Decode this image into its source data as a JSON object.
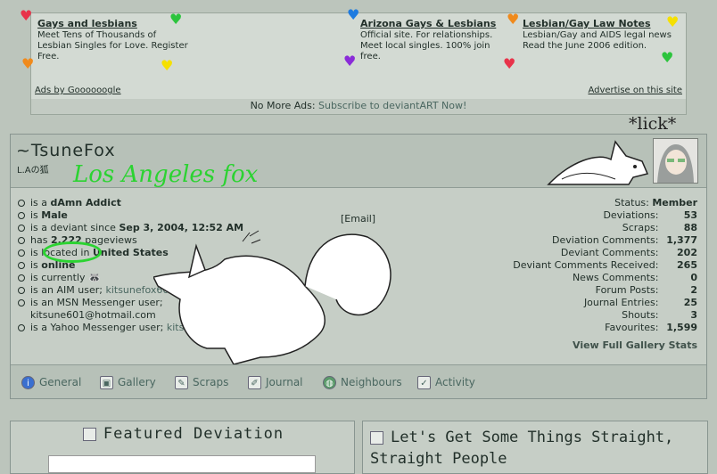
{
  "ads": {
    "items": [
      {
        "title": "Gays and lesbians",
        "text": "Meet Tens of Thousands of Lesbian Singles for Love. Register Free."
      },
      {
        "title": "Arizona Gays & Lesbians",
        "text": "Official site. For relationships. Meet local singles. 100% join free."
      },
      {
        "title": "Lesbian/Gay Law Notes",
        "text": "Lesbian/Gay and AIDS legal news Read the June 2006 edition."
      }
    ],
    "ads_by": "Ads by Goooooogle",
    "advertise": "Advertise on this site",
    "no_ads": "No More Ads:",
    "subscribe": "Subscribe to deviantART Now!"
  },
  "overlay": {
    "lick": "*lick*",
    "green_text": "Los Angeles fox"
  },
  "profile": {
    "username": "~TsuneFox",
    "tagline": "L.Aの狐",
    "email": "[Email]",
    "info": [
      {
        "pre": "is a ",
        "bold": "dAmn Addict",
        "post": ""
      },
      {
        "pre": "is ",
        "bold": "Male",
        "post": ""
      },
      {
        "pre": "is a deviant since ",
        "bold": "Sep 3, 2004, 12:52 AM",
        "post": ""
      },
      {
        "pre": "has ",
        "bold": "2,222",
        "post": " pageviews"
      },
      {
        "pre": "is located in ",
        "bold": "United States",
        "post": ""
      },
      {
        "pre": "is ",
        "bold": "online",
        "post": ""
      },
      {
        "pre": "is currently ",
        "bold": "",
        "post": "🦝"
      },
      {
        "pre": "is an AIM user; ",
        "bold": "",
        "post": "",
        "link": "kitsunefox601"
      },
      {
        "pre": "is an MSN Messenger user; ",
        "bold": "",
        "post": "kitsune601@hotmail.com"
      },
      {
        "pre": "is a Yahoo Messenger user; ",
        "bold": "",
        "post": "",
        "link": "kitsunefox601"
      }
    ],
    "stats": [
      {
        "label": "Status:",
        "value": "Member"
      },
      {
        "label": "Deviations:",
        "value": "53"
      },
      {
        "label": "Scraps:",
        "value": "88"
      },
      {
        "label": "Deviation Comments:",
        "value": "1,377"
      },
      {
        "label": "Deviant Comments:",
        "value": "202"
      },
      {
        "label": "Deviant Comments Received:",
        "value": "265"
      },
      {
        "label": "News Comments:",
        "value": "0"
      },
      {
        "label": "Forum Posts:",
        "value": "2"
      },
      {
        "label": "Journal Entries:",
        "value": "25"
      },
      {
        "label": "Shouts:",
        "value": "3"
      },
      {
        "label": "Favourites:",
        "value": "1,599"
      }
    ],
    "view_stats": "View Full Gallery Stats"
  },
  "nav": [
    {
      "label": "General",
      "icon": "i"
    },
    {
      "label": "Gallery",
      "icon": "▣"
    },
    {
      "label": "Scraps",
      "icon": "✎"
    },
    {
      "label": "Journal",
      "icon": "✐"
    },
    {
      "label": "Neighbours",
      "icon": "◍"
    },
    {
      "label": "Activity",
      "icon": "✓"
    }
  ],
  "featured": {
    "title": "Featured Deviation"
  },
  "journal": {
    "title": "Let's Get Some Things Straight, Straight People"
  },
  "colors": {
    "green_scribble": "#2bd331",
    "hearts": [
      "#e8334a",
      "#2cc43d",
      "#1e7be0",
      "#f5e000",
      "#f08a1c",
      "#8a2bd8"
    ]
  }
}
